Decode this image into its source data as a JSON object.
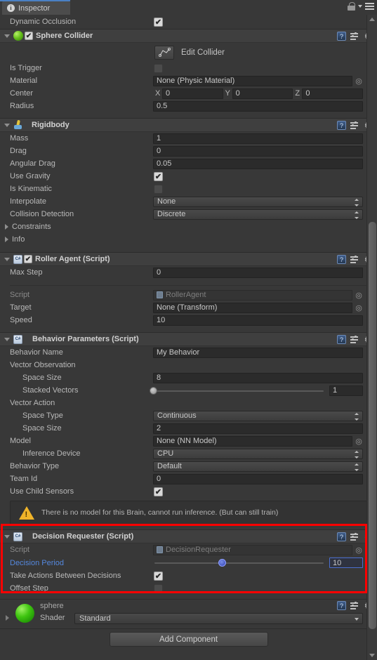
{
  "window": {
    "tab_label": "Inspector",
    "tab_icon": "info-icon",
    "lock_icon": "lock-icon",
    "menu_icon": "hamburger-menu-icon",
    "accent_color": "#4a80c4"
  },
  "top_row": {
    "label": "Dynamic Occlusion",
    "checked": "✔"
  },
  "sphere_collider": {
    "title": "Sphere Collider",
    "enabled_mark": "✔",
    "edit_collider_label": "Edit Collider",
    "rows": {
      "is_trigger": {
        "label": "Is Trigger",
        "value": ""
      },
      "material": {
        "label": "Material",
        "value": "None (Physic Material)"
      },
      "center": {
        "label": "Center",
        "x_axis": "X",
        "x": "0",
        "y_axis": "Y",
        "y": "0",
        "z_axis": "Z",
        "z": "0"
      },
      "radius": {
        "label": "Radius",
        "value": "0.5"
      }
    }
  },
  "rigidbody": {
    "title": "Rigidbody",
    "rows": {
      "mass": {
        "label": "Mass",
        "value": "1"
      },
      "drag": {
        "label": "Drag",
        "value": "0"
      },
      "angular_drag": {
        "label": "Angular Drag",
        "value": "0.05"
      },
      "use_gravity": {
        "label": "Use Gravity",
        "checked": "✔"
      },
      "is_kinematic": {
        "label": "Is Kinematic",
        "checked": ""
      },
      "interpolate": {
        "label": "Interpolate",
        "value": "None"
      },
      "collision_detection": {
        "label": "Collision Detection",
        "value": "Discrete"
      },
      "constraints": {
        "label": "Constraints"
      },
      "info": {
        "label": "Info"
      }
    }
  },
  "roller_agent": {
    "title": "Roller Agent (Script)",
    "enabled_mark": "✔",
    "rows": {
      "max_step": {
        "label": "Max Step",
        "value": "0"
      },
      "script": {
        "label": "Script",
        "value": "RollerAgent"
      },
      "target": {
        "label": "Target",
        "value": "None (Transform)"
      },
      "speed": {
        "label": "Speed",
        "value": "10"
      }
    }
  },
  "behavior_parameters": {
    "title": "Behavior Parameters (Script)",
    "rows": {
      "behavior_name": {
        "label": "Behavior Name",
        "value": "My Behavior"
      },
      "vector_observation": {
        "label": "Vector Observation"
      },
      "obs_space_size": {
        "label": "Space Size",
        "value": "8"
      },
      "stacked_vectors": {
        "label": "Stacked Vectors",
        "value": "1",
        "slider_percent": 0
      },
      "vector_action": {
        "label": "Vector Action"
      },
      "action_space_type": {
        "label": "Space Type",
        "value": "Continuous"
      },
      "action_space_size": {
        "label": "Space Size",
        "value": "2"
      },
      "model": {
        "label": "Model",
        "value": "None (NN Model)"
      },
      "inference_device": {
        "label": "Inference Device",
        "value": "CPU"
      },
      "behavior_type": {
        "label": "Behavior Type",
        "value": "Default"
      },
      "team_id": {
        "label": "Team Id",
        "value": "0"
      },
      "use_child_sensors": {
        "label": "Use Child Sensors",
        "checked": "✔"
      }
    },
    "warning": {
      "icon": "warning-triangle-icon",
      "text": "There is no model for this Brain, cannot run inference. (But can still train)"
    }
  },
  "decision_requester": {
    "title": "Decision Requester (Script)",
    "highlight_color": "#ff0000",
    "rows": {
      "script": {
        "label": "Script",
        "value": "DecisionRequester"
      },
      "decision_period": {
        "label": "Decision Period",
        "value": "10",
        "slider_percent": 40
      },
      "take_actions": {
        "label": "Take Actions Between Decisions",
        "checked": "✔"
      },
      "offset_step": {
        "label": "Offset Step",
        "checked": ""
      }
    }
  },
  "material": {
    "name": "sphere",
    "shader_label": "Shader",
    "shader_value": "Standard"
  },
  "footer": {
    "add_component_label": "Add Component"
  },
  "icons": {
    "help": "?",
    "gear": "⚙"
  }
}
